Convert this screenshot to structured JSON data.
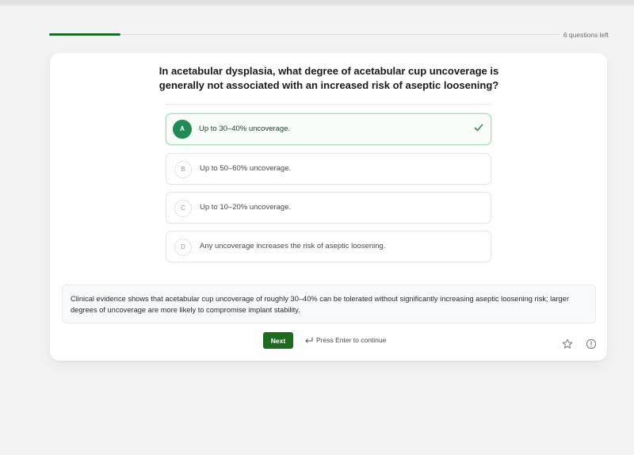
{
  "progress": {
    "fraction": 0.14,
    "questions_left_label": "6 questions left"
  },
  "question": {
    "text": "In acetabular dysplasia, what degree of acetabular cup uncoverage is generally not associated with an increased risk of aseptic loosening?"
  },
  "options": [
    {
      "letter": "A",
      "text": "Up to 30–40% uncoverage.",
      "selected": true
    },
    {
      "letter": "B",
      "text": "Up to 50–60% uncoverage.",
      "selected": false
    },
    {
      "letter": "C",
      "text": "Up to 10–20% uncoverage.",
      "selected": false
    },
    {
      "letter": "D",
      "text": "Any uncoverage increases the risk of aseptic loosening.",
      "selected": false
    }
  ],
  "explanation": {
    "text": "Clinical evidence shows that acetabular cup uncoverage of roughly 30–40% can be tolerated without significantly increasing aseptic loosening risk; larger degrees of uncoverage are more likely to compromise implant stability."
  },
  "footer": {
    "next_label": "Next",
    "enter_hint": "Press Enter to continue"
  },
  "icons": {
    "check": "check-icon",
    "enter": "enter-return-icon",
    "star": "star-icon",
    "info": "info-icon"
  },
  "colors": {
    "accent_green": "#1b6c1f",
    "selected_letter_green": "#1f8c55",
    "selected_border": "#a8dbbd",
    "progress_fill": "#1d6b2c"
  }
}
